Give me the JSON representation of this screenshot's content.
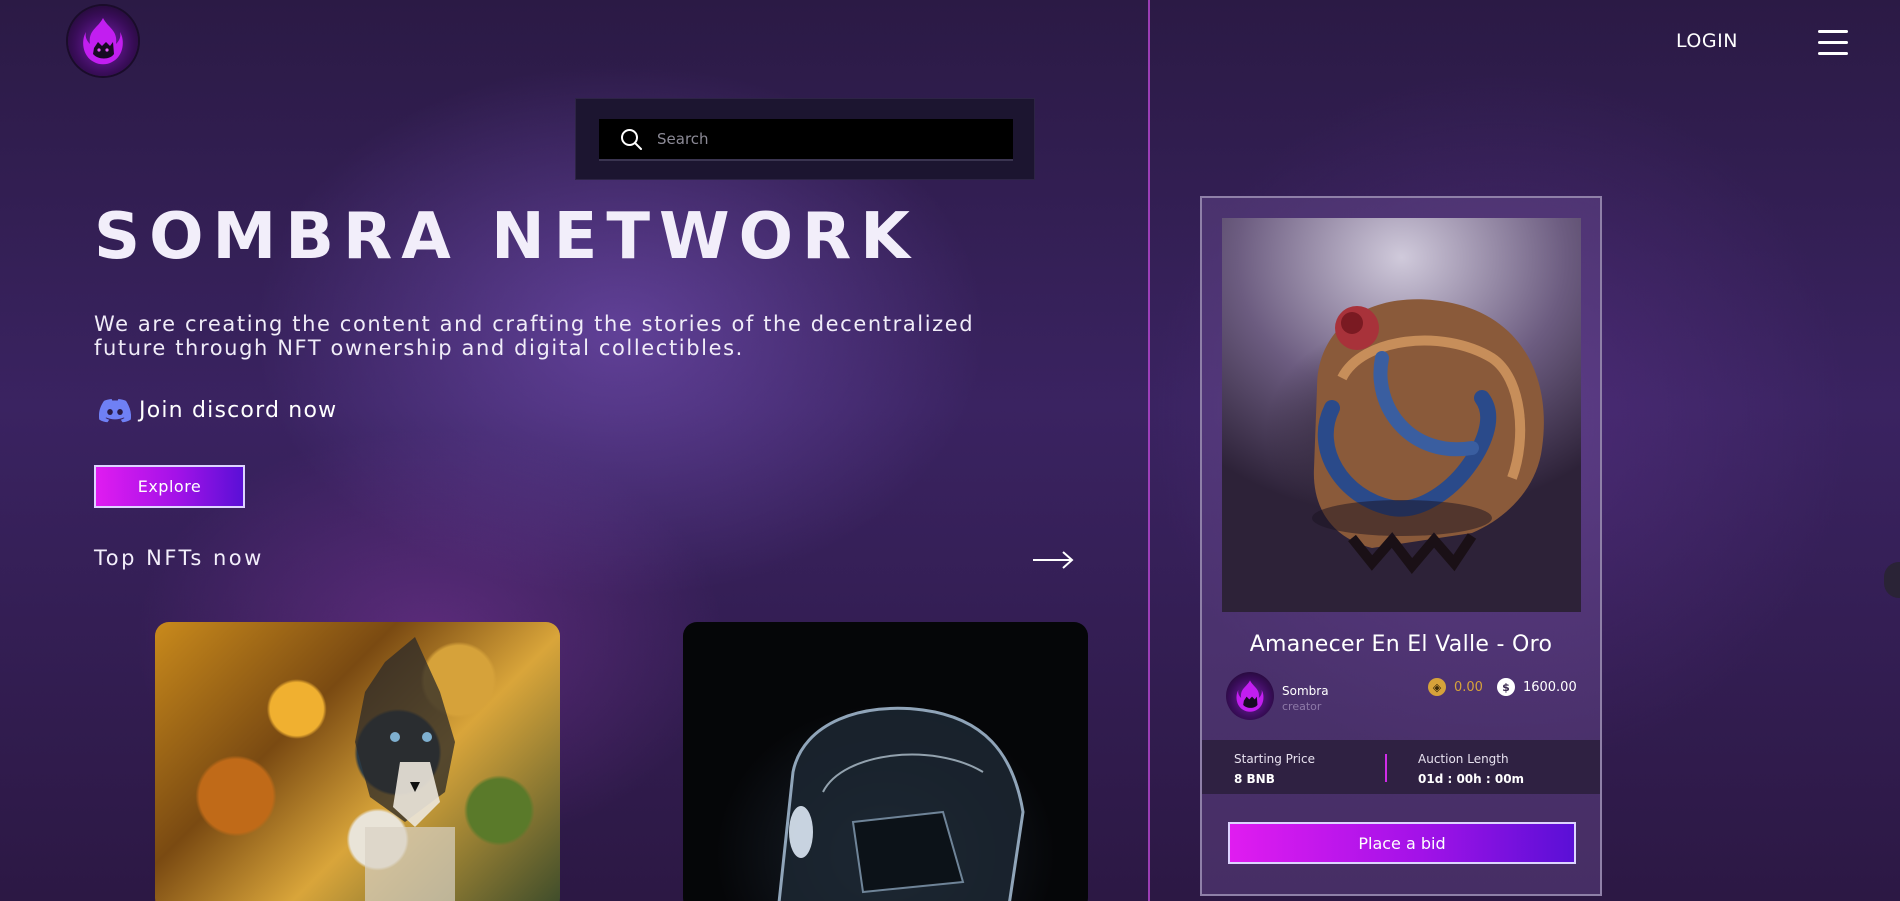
{
  "header": {
    "logo_name": "sombra-flame-logo",
    "login_label": "LOGIN",
    "menu_icon": "hamburger-menu-icon"
  },
  "search": {
    "placeholder": "Search",
    "icon": "search-icon"
  },
  "hero": {
    "title": "SOMBRA NETWORK",
    "subtitle": "We are creating the content and crafting the stories of the decentralized future through NFT ownership and digital collectibles.",
    "discord_label": "Join discord now",
    "discord_icon": "discord-icon",
    "explore_label": "Explore"
  },
  "top_nfts": {
    "title": "Top NFTs now",
    "arrow_icon": "arrow-right-icon"
  },
  "auction_card": {
    "title": "Amanecer En El Valle - Oro",
    "creator_name": "Sombra",
    "creator_role": "creator",
    "price_bnb": "0.00",
    "price_usd": "1600.00",
    "starting_price_label": "Starting Price",
    "starting_price_value": "8 BNB",
    "auction_length_label": "Auction Length",
    "auction_length_value": "01d : 00h : 00m",
    "bid_label": "Place a bid"
  },
  "colors": {
    "accent_magenta": "#e01cf0",
    "accent_violet": "#5a10d6",
    "divider": "#c04ad9",
    "bnb_gold": "#d6a23a"
  }
}
